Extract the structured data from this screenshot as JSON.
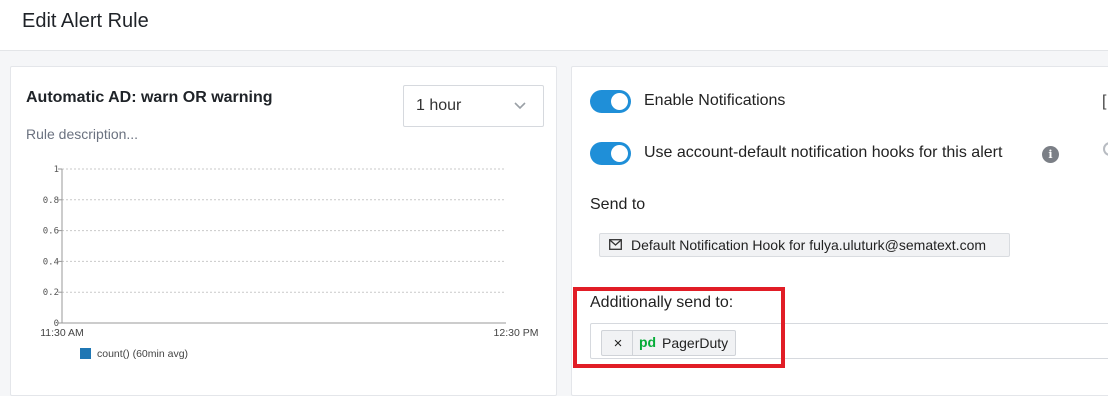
{
  "header": {
    "title": "Edit Alert Rule"
  },
  "rule": {
    "title": "Automatic AD: warn OR warning",
    "description_placeholder": "Rule description...",
    "time_range": "1 hour"
  },
  "chart_data": {
    "type": "line",
    "y_ticks": [
      "1",
      "0.8",
      "0.6",
      "0.4",
      "0.2",
      "0"
    ],
    "x_ticks": [
      "11:30 AM",
      "12:30 PM"
    ],
    "ylim": [
      0,
      1
    ],
    "grid": true,
    "series": [
      {
        "name": "count() (60min avg)",
        "values": [],
        "color": "#1f77b4"
      }
    ],
    "legend": "bottom-left"
  },
  "notifications": {
    "enable_label": "Enable Notifications",
    "enable_on": true,
    "default_hooks_label": "Use account-default notification hooks for this alert",
    "default_hooks_on": true,
    "info_icon": "i",
    "send_to_label": "Send to",
    "default_hook": "Default Notification Hook for fulya.uluturk@sematext.com",
    "additionally_label": "Additionally send to:",
    "additional_hooks": [
      {
        "logo": "pd",
        "name": "PagerDuty",
        "remove": "×"
      }
    ]
  },
  "accent_color": "#1f8fd8",
  "highlight_color": "#e11d26"
}
